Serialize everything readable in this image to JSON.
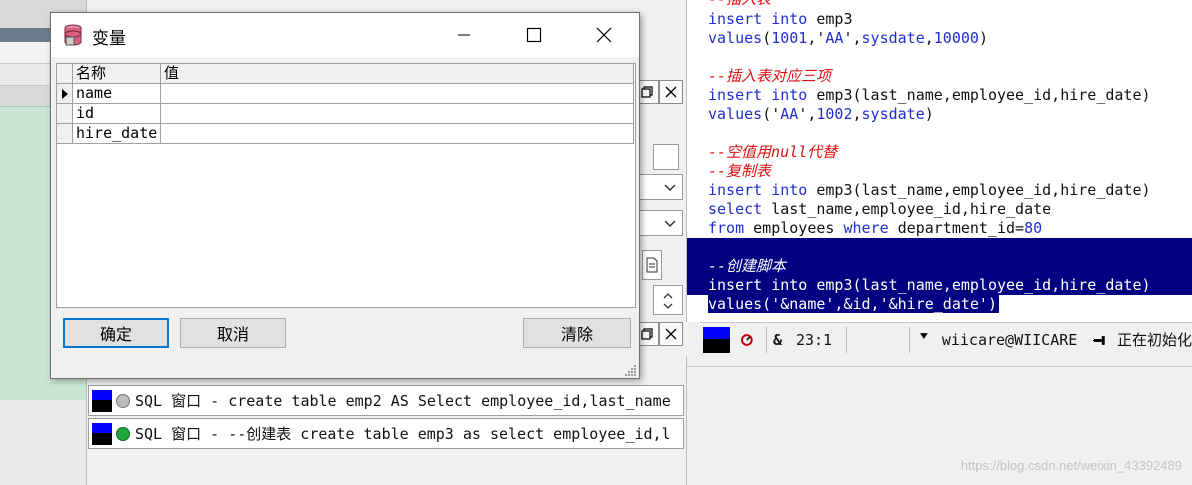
{
  "dialog": {
    "title": "变量",
    "columns": {
      "name": "名称",
      "value": "值"
    },
    "rows": [
      {
        "name": "name",
        "value": ""
      },
      {
        "name": "id",
        "value": ""
      },
      {
        "name": "hire_date",
        "value": ""
      }
    ],
    "buttons": {
      "ok": "确定",
      "cancel": "取消",
      "clear": "清除"
    }
  },
  "editor": {
    "lines": [
      "--插入表",
      "insert into emp3",
      "values(1001,'AA',sysdate,10000)",
      "",
      "--插入表对应三项",
      "insert into emp3(last_name,employee_id,hire_date)",
      "values('AA',1002,sysdate)",
      "",
      "--空值用null代替",
      "--复制表",
      "insert into emp3(last_name,employee_id,hire_date)",
      "select last_name,employee_id,hire_date",
      "from employees where department_id=80",
      "",
      "--创建脚本",
      "insert into emp3(last_name,employee_id,hire_date)",
      "values('&name',&id,'&hire_date')"
    ]
  },
  "statusbar": {
    "amp": "&",
    "position": "23:1",
    "connection": "wiicare@WIICARE",
    "status": "正在初始化"
  },
  "sql_windows": [
    {
      "text": "SQL 窗口 - create table emp2 AS Select employee_id,last_name"
    },
    {
      "text": "SQL 窗口 - --创建表 create table emp3 as select employee_id,l"
    }
  ],
  "watermark": "https://blog.csdn.net/weixin_43392489",
  "colors": {
    "keyword": "#1f2fd0",
    "comment": "#e01010",
    "selection": "#000080",
    "accent": "#0078d7"
  }
}
